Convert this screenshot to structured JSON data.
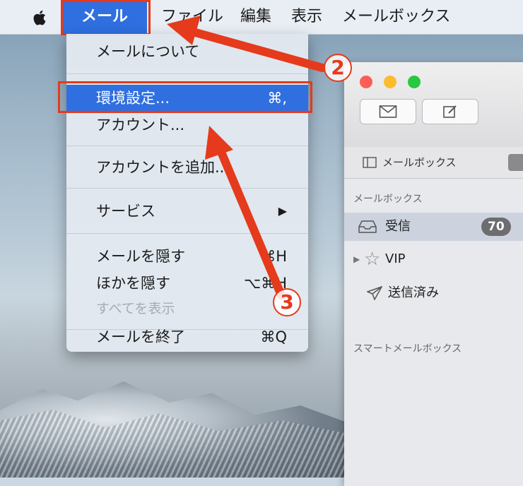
{
  "menubar": {
    "items": [
      "メール",
      "ファイル",
      "編集",
      "表示",
      "メールボックス"
    ]
  },
  "mail_menu": {
    "items": [
      {
        "label": "メールについて",
        "shortcut": ""
      },
      {
        "label": "環境設定...",
        "shortcut": "⌘,"
      },
      {
        "label": "アカウント...",
        "shortcut": ""
      },
      {
        "label": "アカウントを追加...",
        "shortcut": ""
      },
      {
        "label": "サービス",
        "shortcut": "▶"
      },
      {
        "label": "メールを隠す",
        "shortcut": "⌘H"
      },
      {
        "label": "ほかを隠す",
        "shortcut": "⌥⌘H"
      },
      {
        "label": "すべてを表示",
        "shortcut": ""
      },
      {
        "label": "メールを終了",
        "shortcut": "⌘Q"
      }
    ]
  },
  "mail_window": {
    "favorites_button": "メールボックス",
    "sidebar": {
      "section_mailboxes": "メールボックス",
      "inbox": "受信",
      "inbox_count": "70",
      "vip": "VIP",
      "sent": "送信済み",
      "section_smart": "スマートメールボックス"
    }
  },
  "annotations": {
    "step2": "2",
    "step3": "3"
  },
  "colors": {
    "highlight": "#2f6fe0",
    "annotation_red": "#e53a1c"
  }
}
